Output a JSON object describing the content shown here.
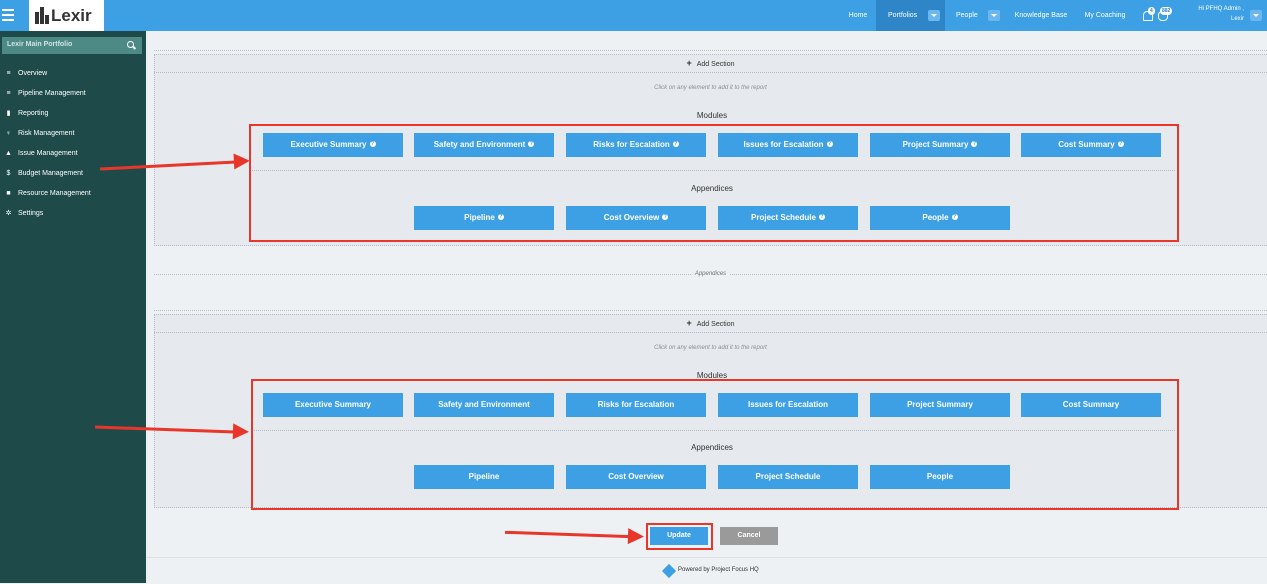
{
  "brand": {
    "logo_text": "Lexir"
  },
  "topnav": {
    "items": [
      {
        "label": "Home"
      },
      {
        "label": "Portfolios"
      },
      {
        "label": "People"
      },
      {
        "label": "Knowledge Base"
      },
      {
        "label": "My Coaching"
      }
    ],
    "notifications_count": "4",
    "people_count": "882",
    "user_line1": "Hi PFHQ Admin ,",
    "user_line2": "Lexir"
  },
  "sidebar": {
    "search_value": "Lexir Main Portfolio",
    "items": [
      {
        "label": "Overview",
        "icon": "list-icon"
      },
      {
        "label": "Pipeline Management",
        "icon": "list-icon"
      },
      {
        "label": "Reporting",
        "icon": "bar-chart-icon"
      },
      {
        "label": "Risk Management",
        "icon": "lightbulb-icon"
      },
      {
        "label": "Issue Management",
        "icon": "warning-icon"
      },
      {
        "label": "Budget Management",
        "icon": "dollar-icon"
      },
      {
        "label": "Resource Management",
        "icon": "folder-icon"
      },
      {
        "label": "Settings",
        "icon": "gears-icon"
      }
    ]
  },
  "section1": {
    "add_section": "Add Section",
    "hint": "Click on any element to add it to the report",
    "modules_heading": "Modules",
    "modules": [
      "Executive Summary",
      "Safety and Environment",
      "Risks for Escalation",
      "Issues for Escalation",
      "Project Summary",
      "Cost Summary"
    ],
    "appendices_heading": "Appendices",
    "appendices": [
      "Pipeline",
      "Cost Overview",
      "Project Schedule",
      "People"
    ]
  },
  "separator_label": "Appendices",
  "section2": {
    "add_section": "Add Section",
    "hint": "Click on any element to add it to the report",
    "modules_heading": "Modules",
    "modules": [
      "Executive Summary",
      "Safety and Environment",
      "Risks for Escalation",
      "Issues for Escalation",
      "Project Summary",
      "Cost Summary"
    ],
    "appendices_heading": "Appendices",
    "appendices": [
      "Pipeline",
      "Cost Overview",
      "Project Schedule",
      "People"
    ]
  },
  "actions": {
    "update_label": "Update",
    "cancel_label": "Cancel"
  },
  "footer": {
    "text": "Powered by Project Focus HQ"
  },
  "colors": {
    "primary": "#3ea0e4",
    "sidebar": "#1f4a4a",
    "highlight": "#e8362a"
  }
}
